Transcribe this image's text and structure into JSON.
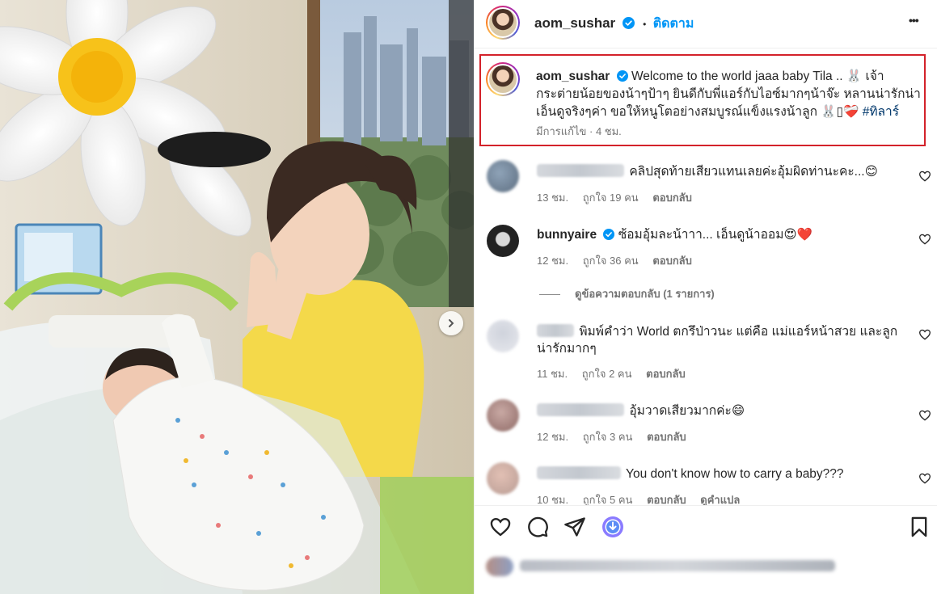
{
  "post": {
    "username": "aom_sushar",
    "follow_label": "ติดตาม",
    "separator": "•",
    "more_label": "•••"
  },
  "caption": {
    "username": "aom_sushar",
    "line1": "Welcome to the world jaaa baby Tila .. 🐰 เจ้า",
    "line2": "กระต่ายน้อยของน้าๆป้าๆ ยินดีกับพี่แอร์กับไอซ์มากๆน้าจ๊ะ หลานน่ารักน่า",
    "line3": "เอ็นดูจริงๆค่า ขอให้หนูโตอย่างสมบูรณ์แข็งแรงน้าลูก 🐰▯❤️‍🩹",
    "hashtag": "#ทิลาร์",
    "edited": "มีการแก้ไข · 4 ชม."
  },
  "comments": [
    {
      "text": "คลิปสุดท้ายเสียวแทนเลยค่ะอุ้มผิดท่านะคะ...😊",
      "time": "13 ชม.",
      "likes": "ถูกใจ 19 คน",
      "reply": "ตอบกลับ"
    },
    {
      "username": "bunnyaire",
      "text": "ซ้อมอุ้มละน้าาา... เอ็นดูน้าออม😍❤️",
      "time": "12 ชม.",
      "likes": "ถูกใจ 36 คน",
      "reply": "ตอบกลับ"
    },
    {
      "line1": "พิมพ์คำว่า World ตกรึป่าวนะ แต่คือ แม่แอร์หน้าสวย และลูก",
      "line2": "น่ารักมากๆ",
      "time": "11 ชม.",
      "likes": "ถูกใจ 2 คน",
      "reply": "ตอบกลับ"
    },
    {
      "text": "อุ้มวาดเสียวมากค่ะ😄",
      "time": "12 ชม.",
      "likes": "ถูกใจ 3 คน",
      "reply": "ตอบกลับ"
    },
    {
      "text": "You don't know how to carry a baby???",
      "time": "10 ชม.",
      "likes": "ถูกใจ 5 คน",
      "reply": "ตอบกลับ",
      "translate": "ดูคำแปล"
    }
  ],
  "view_replies": "ดูข้อความตอบกลับ (1 รายการ)",
  "colors": {
    "accent": "#0095f6",
    "highlight_border": "#d3222a",
    "muted": "#737373",
    "text": "#262626",
    "hashtag": "#00376b"
  },
  "icons": [
    "verified-badge-icon",
    "more-options-icon",
    "heart-icon",
    "comment-icon",
    "share-icon",
    "save-icon",
    "chevron-right-icon"
  ]
}
